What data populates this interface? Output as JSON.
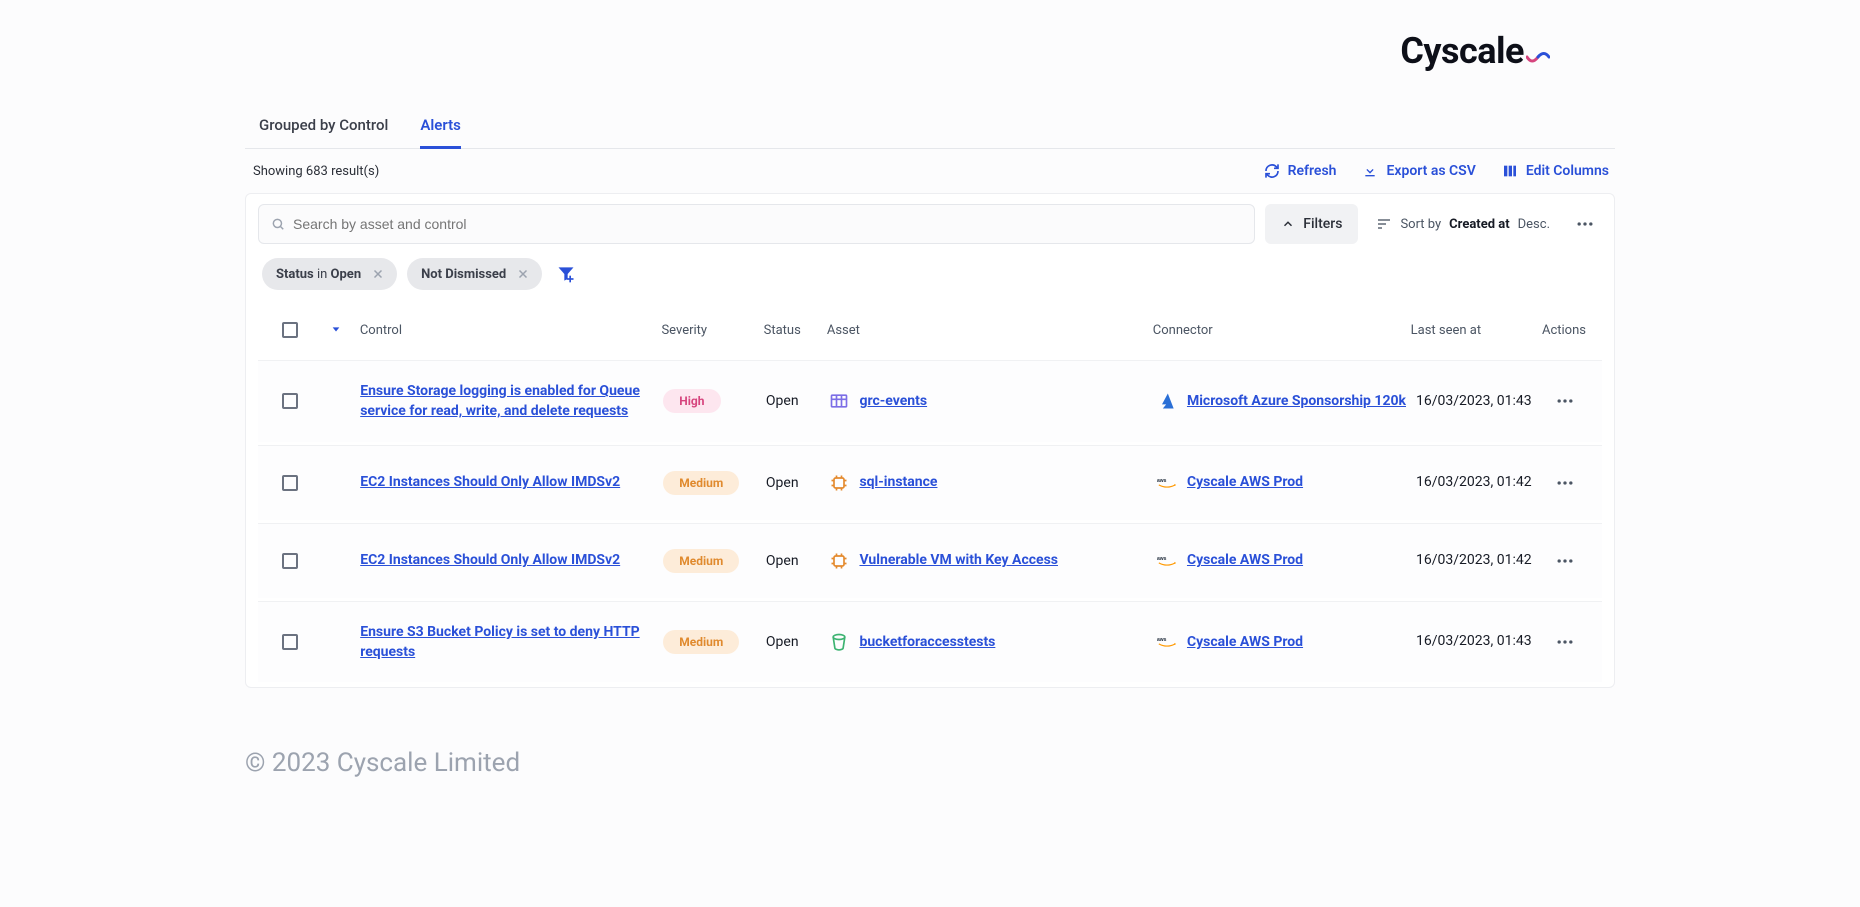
{
  "brand": {
    "name": "Cyscale"
  },
  "tabs": {
    "grouped": "Grouped by Control",
    "alerts": "Alerts"
  },
  "results_text": "Showing 683 result(s)",
  "actions": {
    "refresh": "Refresh",
    "export_csv": "Export as CSV",
    "edit_columns": "Edit Columns"
  },
  "search": {
    "placeholder": "Search by asset and control"
  },
  "filters_btn": "Filters",
  "sort": {
    "prefix": "Sort by",
    "field": "Created at",
    "dir": "Desc."
  },
  "chips": {
    "status_label": "Status",
    "status_op": "in",
    "status_value": "Open",
    "not_dismissed": "Not Dismissed"
  },
  "columns": {
    "control": "Control",
    "severity": "Severity",
    "status": "Status",
    "asset": "Asset",
    "connector": "Connector",
    "last_seen": "Last seen at",
    "actions": "Actions"
  },
  "rows": [
    {
      "control": "Ensure Storage logging is enabled for Queue service for read, write, and delete requests",
      "severity": "High",
      "severity_class": "sev-high",
      "status": "Open",
      "asset": "grc-events",
      "asset_icon": "table-icon",
      "connector": "Microsoft Azure Sponsorship 120k",
      "connector_icon": "azure-icon",
      "last_seen": "16/03/2023, 01:43"
    },
    {
      "control": "EC2 Instances Should Only Allow IMDSv2",
      "severity": "Medium",
      "severity_class": "sev-medium",
      "status": "Open",
      "asset": "sql-instance",
      "asset_icon": "chip-icon",
      "connector": "Cyscale AWS Prod",
      "connector_icon": "aws-icon",
      "last_seen": "16/03/2023, 01:42"
    },
    {
      "control": "EC2 Instances Should Only Allow IMDSv2",
      "severity": "Medium",
      "severity_class": "sev-medium",
      "status": "Open",
      "asset": "Vulnerable VM with Key Access",
      "asset_icon": "chip-icon",
      "connector": "Cyscale AWS Prod",
      "connector_icon": "aws-icon",
      "last_seen": "16/03/2023, 01:42"
    },
    {
      "control": "Ensure S3 Bucket Policy is set to deny HTTP requests",
      "severity": "Medium",
      "severity_class": "sev-medium",
      "status": "Open",
      "asset": "bucketforaccesstests",
      "asset_icon": "bucket-icon",
      "connector": "Cyscale AWS Prod",
      "connector_icon": "aws-icon",
      "last_seen": "16/03/2023, 01:43"
    }
  ],
  "footer": "© 2023 Cyscale Limited"
}
